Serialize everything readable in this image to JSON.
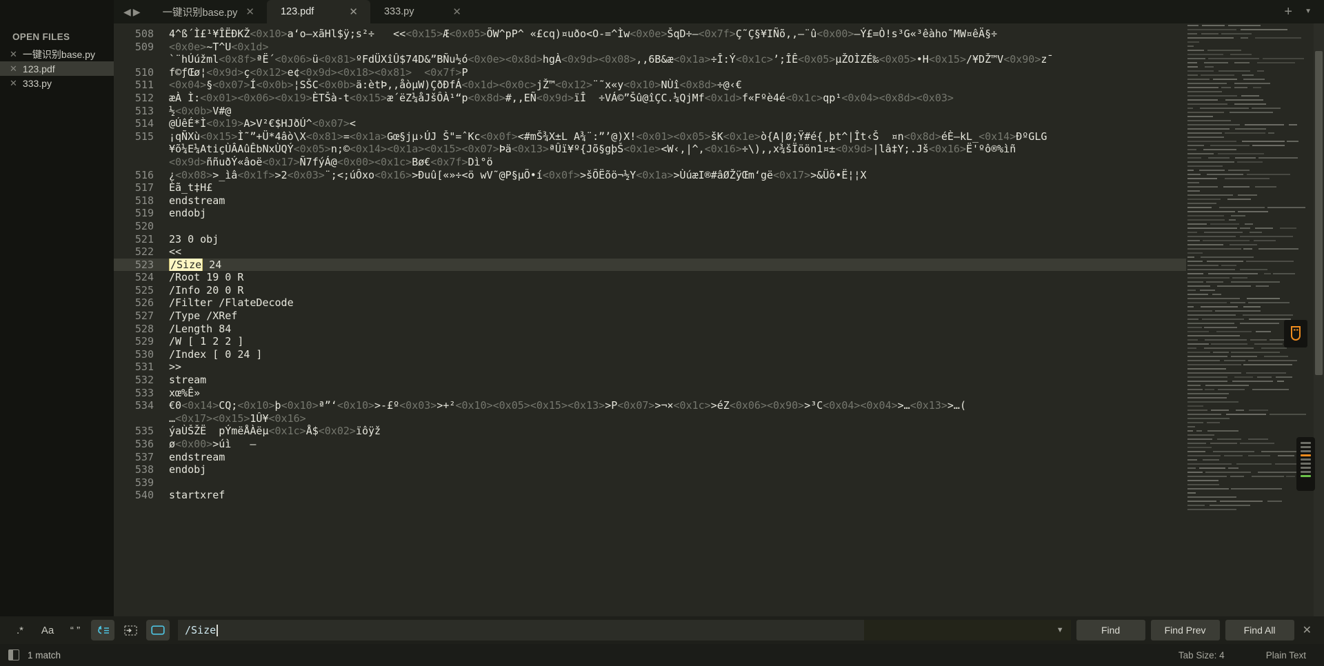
{
  "tabbar": {
    "nav_back_icon": "◀",
    "nav_fwd_icon": "▶",
    "new_tab_icon": "+",
    "tab_list_icon": "▼",
    "close_glyph": "✕",
    "tabs": [
      {
        "label": "一键识别base.py",
        "active": false
      },
      {
        "label": "123.pdf",
        "active": true
      },
      {
        "label": "333.py",
        "active": false
      }
    ]
  },
  "sidebar": {
    "title": "OPEN FILES",
    "close_glyph": "✕",
    "items": [
      {
        "label": "一键识别base.py",
        "selected": false
      },
      {
        "label": "123.pdf",
        "selected": true
      },
      {
        "label": "333.py",
        "selected": false
      }
    ]
  },
  "editor": {
    "first_line": 508,
    "current_line": 523,
    "lines": [
      {
        "num": 508,
        "segs": [
          [
            "t",
            "4^ß´Ì£¹¥ÎËÐKŽ"
          ],
          [
            "h",
            "<0x10>"
          ],
          [
            "t",
            "a‘o—xãHl$ÿ;s²÷   <<"
          ],
          [
            "h",
            "<0x15>"
          ],
          [
            "t",
            "Æ"
          ],
          [
            "h",
            "<0x05>"
          ],
          [
            "t",
            "ÕW^pP^ «£cq)¤uðo<O-=^Ìw"
          ],
          [
            "h",
            "<0x0e>"
          ],
          [
            "t",
            "ŠqD÷—"
          ],
          [
            "h",
            "<0x7f>"
          ],
          [
            "t",
            "Ç˜Ç§¥IÑõ,,—¨û"
          ],
          [
            "h",
            "<0x00>"
          ],
          [
            "t",
            "—Ý£=Ò!s³G«³êàho˜MW¤êÄ§÷"
          ]
        ]
      },
      {
        "num": 509,
        "segs": [
          [
            "h",
            "<0x0e>"
          ],
          [
            "t",
            "~T^U"
          ],
          [
            "h",
            "<0x1d>"
          ]
        ]
      },
      {
        "num": "",
        "segs": [
          [
            "t",
            "`¨hÚúžml"
          ],
          [
            "h",
            "<0x8f>"
          ],
          [
            "t",
            "ªË´"
          ],
          [
            "h",
            "<0x06>"
          ],
          [
            "t",
            "ü"
          ],
          [
            "h",
            "<0x81>"
          ],
          [
            "t",
            "ºFdÜXîÛ$74D&”BÑu½ó"
          ],
          [
            "h",
            "<0x0e>"
          ],
          [
            "h",
            "<0x8d>"
          ],
          [
            "t",
            "hgÀ"
          ],
          [
            "h",
            "<0x9d>"
          ],
          [
            "h",
            "<0x08>"
          ],
          [
            "t",
            ",,6B&æ"
          ],
          [
            "h",
            "<0x1a>"
          ],
          [
            "t",
            "÷Î:Ý"
          ],
          [
            "h",
            "<0x1c>"
          ],
          [
            "t",
            "’;ÎÊ"
          ],
          [
            "h",
            "<0x05>"
          ],
          [
            "t",
            "µŽOÌZÉ‰"
          ],
          [
            "h",
            "<0x05>"
          ],
          [
            "t",
            "•H"
          ],
          [
            "h",
            "<0x15>"
          ],
          [
            "t",
            "/¥DŽ™V"
          ],
          [
            "h",
            "<0x90>"
          ],
          [
            "t",
            "z¯"
          ]
        ]
      },
      {
        "num": 510,
        "segs": [
          [
            "t",
            "f©ƒŒø¦"
          ],
          [
            "h",
            "<0x9d>"
          ],
          [
            "t",
            "ç"
          ],
          [
            "h",
            "<0x12>"
          ],
          [
            "t",
            "e¢"
          ],
          [
            "h",
            "<0x9d>"
          ],
          [
            "h",
            "<0x18>"
          ],
          [
            "h",
            "<0x81>"
          ],
          [
            "t",
            "  "
          ],
          [
            "h",
            "<0x7f>"
          ],
          [
            "t",
            "P"
          ]
        ]
      },
      {
        "num": 511,
        "segs": [
          [
            "h",
            "<0x04>"
          ],
          [
            "t",
            "§"
          ],
          [
            "h",
            "<0x07>"
          ],
          [
            "t",
            "Í"
          ],
          [
            "h",
            "<0x0b>"
          ],
          [
            "t",
            "¦SŠC"
          ],
          [
            "h",
            "<0x0b>"
          ],
          [
            "t",
            "ä:ètÞ,,åòµW)ÇðÐfÁ"
          ],
          [
            "h",
            "<0x1d>"
          ],
          [
            "h",
            "<0x0c>"
          ],
          [
            "t",
            "jŽ™"
          ],
          [
            "h",
            "<0x12>"
          ],
          [
            "t",
            "¨˜x«y"
          ],
          [
            "h",
            "<0x10>"
          ],
          [
            "t",
            "NÙî"
          ],
          [
            "h",
            "<0x8d>"
          ],
          [
            "t",
            "÷@‹€"
          ]
        ]
      },
      {
        "num": 512,
        "segs": [
          [
            "t",
            "æÀ Ì:"
          ],
          [
            "h",
            "<0x01>"
          ],
          [
            "h",
            "<0x06>"
          ],
          [
            "h",
            "<0x19>"
          ],
          [
            "t",
            "ÈTŠà-t"
          ],
          [
            "h",
            "<0x15>"
          ],
          [
            "t",
            "æ´ëZ¼åJšÔÀ¹“p"
          ],
          [
            "h",
            "<0x8d>"
          ],
          [
            "t",
            "#,,EÑ"
          ],
          [
            "h",
            "<0x9d>"
          ],
          [
            "t",
            "ïÎ  ÷VÁ©”Šû@îÇC.¼QjMf"
          ],
          [
            "h",
            "<0x1d>"
          ],
          [
            "t",
            "f«Fºè4é"
          ],
          [
            "h",
            "<0x1c>"
          ],
          [
            "t",
            "qp¹"
          ],
          [
            "h",
            "<0x04>"
          ],
          [
            "h",
            "<0x8d>"
          ],
          [
            "h",
            "<0x03>"
          ]
        ]
      },
      {
        "num": 513,
        "segs": [
          [
            "t",
            "½"
          ],
          [
            "h",
            "<0x0b>"
          ],
          [
            "t",
            "V#@"
          ]
        ]
      },
      {
        "num": 514,
        "segs": [
          [
            "t",
            "@ÚêÉ*Ì"
          ],
          [
            "h",
            "<0x19>"
          ],
          [
            "t",
            "A>V²€$HJðÚ^"
          ],
          [
            "h",
            "<0x07>"
          ],
          [
            "t",
            "<"
          ]
        ]
      },
      {
        "num": 515,
        "segs": [
          [
            "t",
            "¡qÑXù"
          ],
          [
            "h",
            "<0x15>"
          ],
          [
            "t",
            "Ì˜”+Ü*4âò\\X"
          ],
          [
            "h",
            "<0x81>"
          ],
          [
            "t",
            "="
          ],
          [
            "h",
            "<0x1a>"
          ],
          [
            "t",
            "Gœ§jµ›ÚJ Š\"=ˆKc"
          ],
          [
            "h",
            "<0x0f>"
          ],
          [
            "t",
            "<#mŠ¾X±L A¾¨:”’@)X!"
          ],
          [
            "h",
            "<0x01>"
          ],
          [
            "h",
            "<0x05>"
          ],
          [
            "t",
            "šK"
          ],
          [
            "h",
            "<0x1e>"
          ],
          [
            "t",
            "ò{A|Ø;Ÿ#é{¸þt^|Ît‹Š  ¤n"
          ],
          [
            "h",
            "<0x8d>"
          ],
          [
            "t",
            "éÈ—kL_"
          ],
          [
            "h",
            "<0x14>"
          ],
          [
            "t",
            "ÐºGLG"
          ]
        ]
      },
      {
        "num": "",
        "segs": [
          [
            "t",
            "¥õ¼E¼AtiçÙÂAûÊbNxÙQÝ"
          ],
          [
            "h",
            "<0x05>"
          ],
          [
            "t",
            "n;©"
          ],
          [
            "h",
            "<0x14>"
          ],
          [
            "h",
            "<0x1a>"
          ],
          [
            "h",
            "<0x15>"
          ],
          [
            "h",
            "<0x07>"
          ],
          [
            "t",
            "Þä"
          ],
          [
            "h",
            "<0x13>"
          ],
          [
            "t",
            "ªÛï¥º{Jõ§gþŠ"
          ],
          [
            "h",
            "<0x1e>"
          ],
          [
            "t",
            "<W‹,|^,"
          ],
          [
            "h",
            "<0x16>"
          ],
          [
            "t",
            "÷\\),,x¾šÏöön1¤±"
          ],
          [
            "h",
            "<0x9d>"
          ],
          [
            "t",
            "|lâ‡Y;.Jš"
          ],
          [
            "h",
            "<0x16>"
          ],
          [
            "t",
            "Ë'ºô®%ìñ"
          ]
        ]
      },
      {
        "num": "",
        "segs": [
          [
            "h",
            "<0x9d>"
          ],
          [
            "t",
            "ññuðÝ«âoë"
          ],
          [
            "h",
            "<0x17>"
          ],
          [
            "t",
            "Ñ7fýÁ@"
          ],
          [
            "h",
            "<0x00>"
          ],
          [
            "h",
            "<0x1c>"
          ],
          [
            "t",
            "Bø€"
          ],
          [
            "h",
            "<0x7f>"
          ],
          [
            "t",
            "Dì°ö"
          ]
        ]
      },
      {
        "num": 516,
        "segs": [
          [
            "t",
            "¿"
          ],
          [
            "h",
            "<0x08>"
          ],
          [
            "t",
            ">_ìâ"
          ],
          [
            "h",
            "<0x1f>"
          ],
          [
            "t",
            ">2"
          ],
          [
            "h",
            "<0x03>"
          ],
          [
            "t",
            "¨;<;úÔxo"
          ],
          [
            "h",
            "<0x16>"
          ],
          [
            "t",
            ">Ðuû[«»÷<ö wV˜@P§µÕ•í"
          ],
          [
            "h",
            "<0x0f>"
          ],
          [
            "t",
            ">šÕËõö¬½Y"
          ],
          [
            "h",
            "<0x1a>"
          ],
          [
            "t",
            ">ÙúæI®#âØŽÿŒm‘gë"
          ],
          [
            "h",
            "<0x17>"
          ],
          [
            "t",
            ">&Üõ•Ë¦¦X"
          ]
        ]
      },
      {
        "num": 517,
        "segs": [
          [
            "t",
            "Èã_t‡H£"
          ]
        ]
      },
      {
        "num": 518,
        "segs": [
          [
            "t",
            "endstream"
          ]
        ]
      },
      {
        "num": 519,
        "segs": [
          [
            "t",
            "endobj"
          ]
        ]
      },
      {
        "num": 520,
        "segs": []
      },
      {
        "num": 521,
        "segs": [
          [
            "t",
            "23 0 obj"
          ]
        ]
      },
      {
        "num": 522,
        "segs": [
          [
            "t",
            "<<"
          ]
        ]
      },
      {
        "num": 523,
        "segs": [
          [
            "m",
            "/Size"
          ],
          [
            "t",
            " 24"
          ]
        ]
      },
      {
        "num": 524,
        "segs": [
          [
            "t",
            "/Root 19 0 R"
          ]
        ]
      },
      {
        "num": 525,
        "segs": [
          [
            "t",
            "/Info 20 0 R"
          ]
        ]
      },
      {
        "num": 526,
        "segs": [
          [
            "t",
            "/Filter /FlateDecode"
          ]
        ]
      },
      {
        "num": 527,
        "segs": [
          [
            "t",
            "/Type /XRef"
          ]
        ]
      },
      {
        "num": 528,
        "segs": [
          [
            "t",
            "/Length 84"
          ]
        ]
      },
      {
        "num": 529,
        "segs": [
          [
            "t",
            "/W [ 1 2 2 ]"
          ]
        ]
      },
      {
        "num": 530,
        "segs": [
          [
            "t",
            "/Index [ 0 24 ]"
          ]
        ]
      },
      {
        "num": 531,
        "segs": [
          [
            "t",
            ">>"
          ]
        ]
      },
      {
        "num": 532,
        "segs": [
          [
            "t",
            "stream"
          ]
        ]
      },
      {
        "num": 533,
        "segs": [
          [
            "t",
            "xœ%Ê»"
          ]
        ]
      },
      {
        "num": 534,
        "segs": [
          [
            "t",
            "€0"
          ],
          [
            "h",
            "<0x14>"
          ],
          [
            "t",
            "CQ;"
          ],
          [
            "h",
            "<0x10>"
          ],
          [
            "t",
            "þ"
          ],
          [
            "h",
            "<0x10>"
          ],
          [
            "t",
            "ª”‘"
          ],
          [
            "h",
            "<0x10>"
          ],
          [
            "t",
            ">-£º"
          ],
          [
            "h",
            "<0x03>"
          ],
          [
            "t",
            ">+²"
          ],
          [
            "h",
            "<0x10>"
          ],
          [
            "h",
            "<0x05>"
          ],
          [
            "h",
            "<0x15>"
          ],
          [
            "h",
            "<0x13>"
          ],
          [
            "t",
            ">P"
          ],
          [
            "h",
            "<0x07>"
          ],
          [
            "t",
            ">¬×"
          ],
          [
            "h",
            "<0x1c>"
          ],
          [
            "t",
            ">éZ"
          ],
          [
            "h",
            "<0x06>"
          ],
          [
            "h",
            "<0x90>"
          ],
          [
            "t",
            ">³C"
          ],
          [
            "h",
            "<0x04>"
          ],
          [
            "h",
            "<0x04>"
          ],
          [
            "t",
            ">…"
          ],
          [
            "h",
            "<0x13>"
          ],
          [
            "t",
            ">…("
          ]
        ]
      },
      {
        "num": "",
        "segs": [
          [
            "t",
            "…"
          ],
          [
            "h",
            "<0x17>"
          ],
          [
            "h",
            "<0x15>"
          ],
          [
            "t",
            "1Û¥"
          ],
          [
            "h",
            "<0x16>"
          ]
        ]
      },
      {
        "num": 535,
        "segs": [
          [
            "t",
            "ýaÙŠŽË  pÝmëÅÀëµ"
          ],
          [
            "h",
            "<0x1c>"
          ],
          [
            "t",
            "Å$"
          ],
          [
            "h",
            "<0x02>"
          ],
          [
            "t",
            "ïôÿž"
          ]
        ]
      },
      {
        "num": 536,
        "segs": [
          [
            "t",
            "ø"
          ],
          [
            "h",
            "<0x00>"
          ],
          [
            "t",
            ">úì   –"
          ]
        ]
      },
      {
        "num": 537,
        "segs": [
          [
            "t",
            "endstream"
          ]
        ]
      },
      {
        "num": 538,
        "segs": [
          [
            "t",
            "endobj"
          ]
        ]
      },
      {
        "num": 539,
        "segs": []
      },
      {
        "num": 540,
        "segs": [
          [
            "t",
            "startxref"
          ]
        ]
      }
    ]
  },
  "overlay": {
    "usb_icon": "usb-device-icon",
    "server_icon": "server-rack-icon",
    "accent_orange": "#f08c1e",
    "accent_green": "#6cc24a"
  },
  "findbar": {
    "regex_label": ".*",
    "case_label": "Aa",
    "wholeword_label": "“ ”",
    "wrap_icon": "↺≡",
    "in_selection_icon": "⇥",
    "highlight_icon": "▭",
    "query": "/Size",
    "placeholder": "",
    "history_caret": "▼",
    "find_label": "Find",
    "find_prev_label": "Find Prev",
    "find_all_label": "Find All",
    "close_glyph": "✕"
  },
  "statusbar": {
    "panel_icon": "panel-toggle-icon",
    "match_text": "1 match",
    "tab_size": "Tab Size: 4",
    "syntax": "Plain Text"
  },
  "colors": {
    "bg": "#1b1c18",
    "editor_bg": "#272822",
    "sidebar_bg": "#131410",
    "accent_cyan": "#4ec3e0",
    "match_highlight": "#fdf6c3",
    "current_line": "#3b3c34"
  }
}
